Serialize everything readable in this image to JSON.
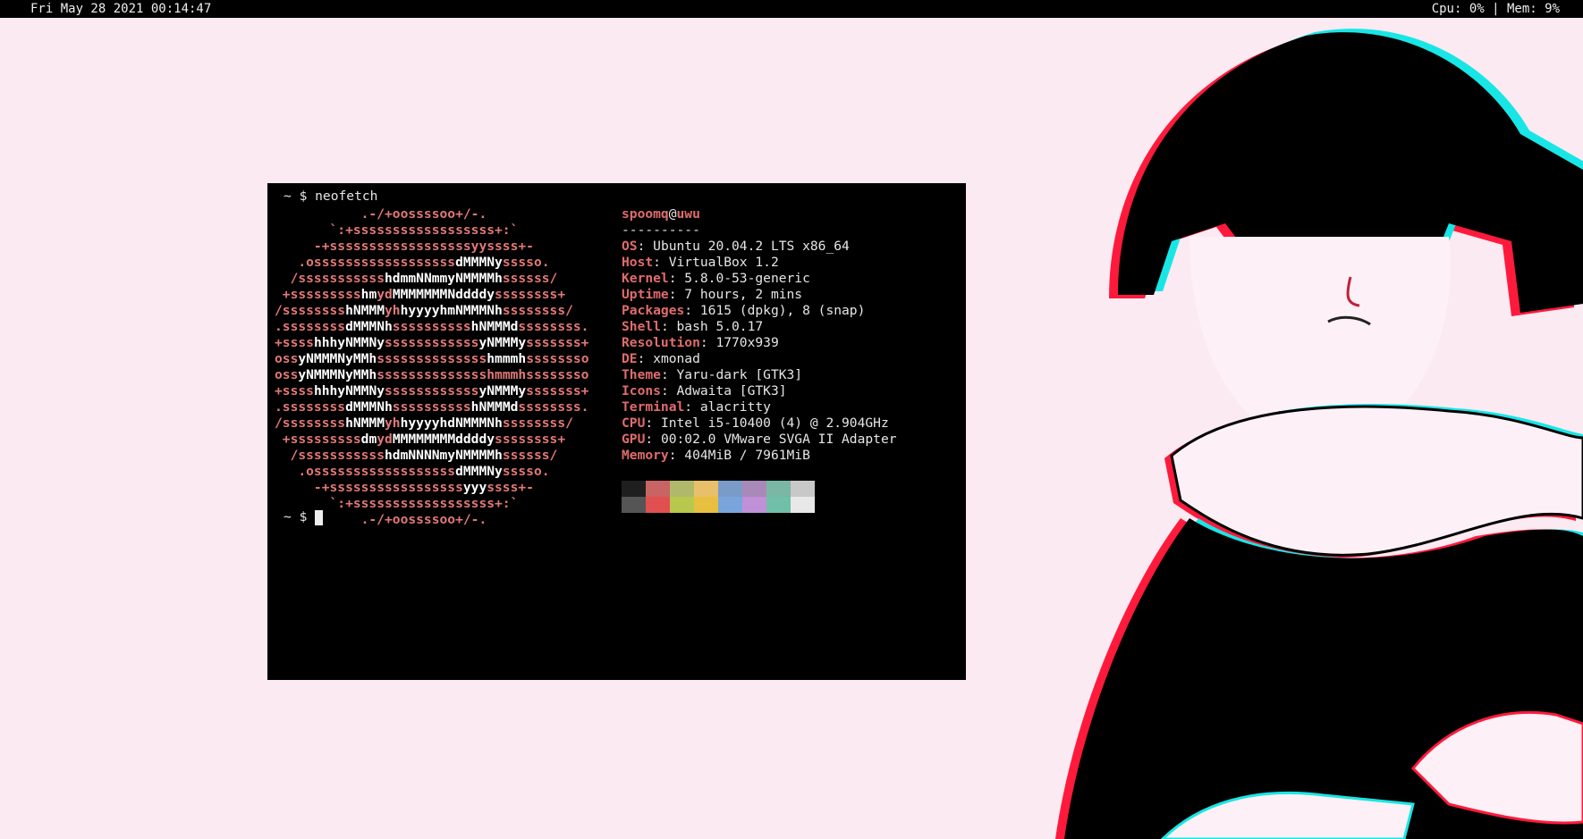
{
  "statusbar": {
    "datetime": "Fri May 28 2021 00:14:47",
    "system": "Cpu: 0% | Mem: 9%"
  },
  "terminal": {
    "prompt1": "~ $ neofetch",
    "prompt2": "~ $ ",
    "ascii_lines": [
      [
        {
          "t": "           .-/+oossssoo+/-."
        }
      ],
      [
        {
          "t": "       `:+ssssssssssssssssss+:`"
        }
      ],
      [
        {
          "t": "     -+ssssssssssssssssssyyssss+-"
        }
      ],
      [
        {
          "t": "   .ossssssssssssssssss"
        },
        {
          "t": "dMMMNy",
          "w": true
        },
        {
          "t": "sssso."
        }
      ],
      [
        {
          "t": "  /sssssssssss"
        },
        {
          "t": "hdmmNNmmyNMMMMh",
          "w": true
        },
        {
          "t": "ssssss/"
        }
      ],
      [
        {
          "t": " +sssssssss"
        },
        {
          "t": "hm",
          "w": true
        },
        {
          "t": "yd"
        },
        {
          "t": "MMMMMMMNddddy",
          "w": true
        },
        {
          "t": "ssssssss+"
        }
      ],
      [
        {
          "t": "/ssssssss"
        },
        {
          "t": "hNMMM",
          "w": true
        },
        {
          "t": "yh"
        },
        {
          "t": "hyyyyhmNMMMNh",
          "w": true
        },
        {
          "t": "ssssssss/"
        }
      ],
      [
        {
          "t": ".ssssssss"
        },
        {
          "t": "dMMMNh",
          "w": true
        },
        {
          "t": "ssssssssss"
        },
        {
          "t": "hNMMMd",
          "w": true
        },
        {
          "t": "ssssssss."
        }
      ],
      [
        {
          "t": "+ssss"
        },
        {
          "t": "hhhyNMMNy",
          "w": true
        },
        {
          "t": "ssssssssssss"
        },
        {
          "t": "yNMMMy",
          "w": true
        },
        {
          "t": "sssssss+"
        }
      ],
      [
        {
          "t": "oss"
        },
        {
          "t": "yNMMMNyMMh",
          "w": true
        },
        {
          "t": "ssssssssssssss"
        },
        {
          "t": "hmmmh",
          "w": true
        },
        {
          "t": "ssssssso"
        }
      ],
      [
        {
          "t": "oss"
        },
        {
          "t": "yNMMMNyMMh",
          "w": true
        },
        {
          "t": "sssssssssssssshmmmhssssssso"
        }
      ],
      [
        {
          "t": "+ssss"
        },
        {
          "t": "hhhyNMMNy",
          "w": true
        },
        {
          "t": "ssssssssssss"
        },
        {
          "t": "yNMMMy",
          "w": true
        },
        {
          "t": "sssssss+"
        }
      ],
      [
        {
          "t": ".ssssssss"
        },
        {
          "t": "dMMMNh",
          "w": true
        },
        {
          "t": "ssssssssss"
        },
        {
          "t": "hNMMMd",
          "w": true
        },
        {
          "t": "ssssssss."
        }
      ],
      [
        {
          "t": "/ssssssss"
        },
        {
          "t": "hNMMM",
          "w": true
        },
        {
          "t": "yh"
        },
        {
          "t": "hyyyyhdNMMMNh",
          "w": true
        },
        {
          "t": "ssssssss/"
        }
      ],
      [
        {
          "t": " +sssssssss"
        },
        {
          "t": "dm",
          "w": true
        },
        {
          "t": "yd"
        },
        {
          "t": "MMMMMMMMddddy",
          "w": true
        },
        {
          "t": "ssssssss+"
        }
      ],
      [
        {
          "t": "  /sssssssssss"
        },
        {
          "t": "hdmNNNNmyNMMMMh",
          "w": true
        },
        {
          "t": "ssssss/"
        }
      ],
      [
        {
          "t": "   .ossssssssssssssssss"
        },
        {
          "t": "dMMMNy",
          "w": true
        },
        {
          "t": "sssso."
        }
      ],
      [
        {
          "t": "     -+sssssssssssssssss"
        },
        {
          "t": "yyy",
          "w": true
        },
        {
          "t": "ssss+-"
        }
      ],
      [
        {
          "t": "       `:+ssssssssssssssssss+:`"
        }
      ],
      [
        {
          "t": "           .-/+oossssoo+/-."
        }
      ]
    ],
    "user": "spoomq",
    "at": "@",
    "host": "uwu",
    "separator": "----------",
    "info": [
      {
        "key": "OS",
        "value": "Ubuntu 20.04.2 LTS x86_64"
      },
      {
        "key": "Host",
        "value": "VirtualBox 1.2"
      },
      {
        "key": "Kernel",
        "value": "5.8.0-53-generic"
      },
      {
        "key": "Uptime",
        "value": "7 hours, 2 mins"
      },
      {
        "key": "Packages",
        "value": "1615 (dpkg), 8 (snap)"
      },
      {
        "key": "Shell",
        "value": "bash 5.0.17"
      },
      {
        "key": "Resolution",
        "value": "1770x939"
      },
      {
        "key": "DE",
        "value": "xmonad"
      },
      {
        "key": "Theme",
        "value": "Yaru-dark [GTK3]"
      },
      {
        "key": "Icons",
        "value": "Adwaita [GTK3]"
      },
      {
        "key": "Terminal",
        "value": "alacritty"
      },
      {
        "key": "CPU",
        "value": "Intel i5-10400 (4) @ 2.904GHz"
      },
      {
        "key": "GPU",
        "value": "00:02.0 VMware SVGA II Adapter"
      },
      {
        "key": "Memory",
        "value": "404MiB / 7961MiB"
      }
    ],
    "palette_top": [
      "#1f1f1f",
      "#c86464",
      "#b0b96a",
      "#e8c06a",
      "#7a9bc7",
      "#a889b8",
      "#7ab8a5",
      "#c8c8c8"
    ],
    "palette_bottom": [
      "#555555",
      "#e05050",
      "#b8c84c",
      "#e8c040",
      "#7aa4dc",
      "#c090d8",
      "#70c0a8",
      "#e8e8e8"
    ]
  }
}
